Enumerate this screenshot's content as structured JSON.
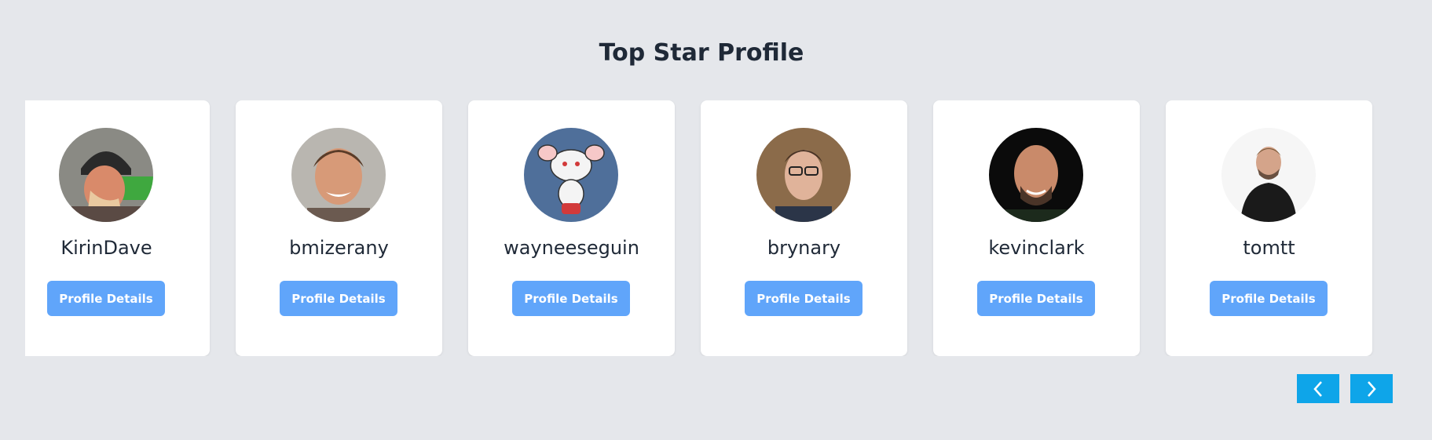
{
  "section": {
    "title": "Top Star Profile"
  },
  "profiles": [
    {
      "username": "KirinDave",
      "button_label": "Profile Details"
    },
    {
      "username": "bmizerany",
      "button_label": "Profile Details"
    },
    {
      "username": "wayneeseguin",
      "button_label": "Profile Details"
    },
    {
      "username": "brynary",
      "button_label": "Profile Details"
    },
    {
      "username": "kevinclark",
      "button_label": "Profile Details"
    },
    {
      "username": "tomtt",
      "button_label": "Profile Details"
    }
  ],
  "carousel_nav": {
    "prev_icon": "chevron-left-icon",
    "next_icon": "chevron-right-icon"
  },
  "colors": {
    "page_background": "#e5e7eb",
    "card_background": "#ffffff",
    "button": "#60a5fa",
    "nav_button": "#0ea5e9",
    "text": "#1f2937"
  }
}
